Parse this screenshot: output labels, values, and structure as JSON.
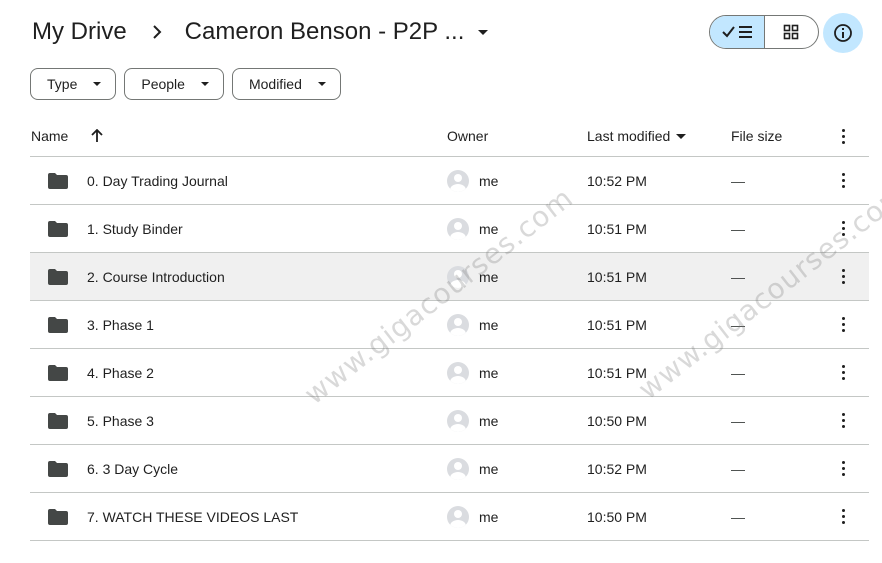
{
  "header": {
    "root": "My Drive",
    "current_folder": "Cameron Benson - P2P ..."
  },
  "toolbar": {
    "view_list_icon": "check-list-icon",
    "view_grid_icon": "grid-icon",
    "info_icon": "info-icon"
  },
  "filters": [
    {
      "label": "Type"
    },
    {
      "label": "People"
    },
    {
      "label": "Modified"
    }
  ],
  "columns": {
    "name": "Name",
    "owner": "Owner",
    "last_modified": "Last modified",
    "file_size": "File size"
  },
  "rows": [
    {
      "name": "0. Day Trading Journal",
      "owner": "me",
      "modified": "10:52 PM",
      "size": "—"
    },
    {
      "name": "1. Study Binder",
      "owner": "me",
      "modified": "10:51 PM",
      "size": "—"
    },
    {
      "name": "2. Course Introduction",
      "owner": "me",
      "modified": "10:51 PM",
      "size": "—"
    },
    {
      "name": "3. Phase 1",
      "owner": "me",
      "modified": "10:51 PM",
      "size": "—"
    },
    {
      "name": "4. Phase 2",
      "owner": "me",
      "modified": "10:51 PM",
      "size": "—"
    },
    {
      "name": "5. Phase 3",
      "owner": "me",
      "modified": "10:50 PM",
      "size": "—"
    },
    {
      "name": "6. 3 Day Cycle",
      "owner": "me",
      "modified": "10:52 PM",
      "size": "—"
    },
    {
      "name": "7. WATCH THESE VIDEOS LAST",
      "owner": "me",
      "modified": "10:50 PM",
      "size": "—"
    }
  ],
  "watermark": {
    "text_left": "www.gigacourses.com",
    "text_right": "www.gigacourses.com"
  },
  "colors": {
    "accent_light": "#c2e7ff",
    "text": "#1f1f1f",
    "divider": "#c4c7c5",
    "folder": "#444746",
    "selected_row": "#f0f0f0"
  }
}
